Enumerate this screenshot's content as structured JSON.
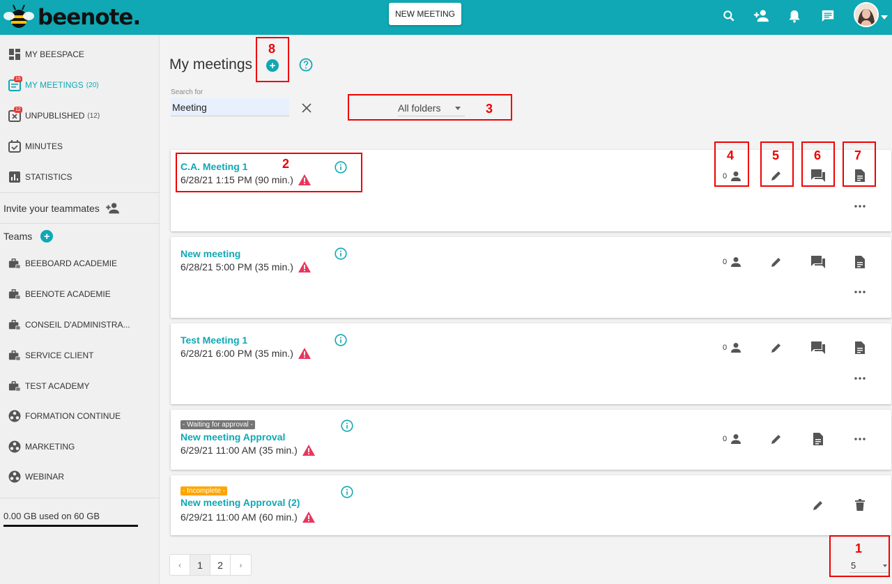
{
  "brand": {
    "logo_text": "beenote."
  },
  "topbar": {
    "new_meeting_label": "NEW MEETING"
  },
  "sidebar": {
    "items": [
      {
        "label": "MY BEESPACE",
        "count": "",
        "badge": ""
      },
      {
        "label": "MY MEETINGS",
        "count": "(20)",
        "badge": "15"
      },
      {
        "label": "UNPUBLISHED",
        "count": "(12)",
        "badge": "12"
      },
      {
        "label": "MINUTES",
        "count": "",
        "badge": ""
      },
      {
        "label": "STATISTICS",
        "count": "",
        "badge": ""
      }
    ],
    "invite_label": "Invite your teammates",
    "teams_label": "Teams",
    "teams": [
      {
        "label": "BEEBOARD ACADEMIE"
      },
      {
        "label": "BEENOTE ACADEMIE"
      },
      {
        "label": "CONSEIL D'ADMINISTRA..."
      },
      {
        "label": "SERVICE CLIENT"
      },
      {
        "label": "TEST ACADEMY"
      },
      {
        "label": "FORMATION CONTINUE"
      },
      {
        "label": "MARKETING"
      },
      {
        "label": "WEBINAR"
      }
    ],
    "storage": "0.00 GB used on 60 GB"
  },
  "main": {
    "title": "My meetings",
    "search_label": "Search for",
    "search_value": "Meeting",
    "folder_filter": "All folders",
    "meetings": [
      {
        "title": "C.A. Meeting 1",
        "date": "6/28/21 1:15 PM (90 min.)",
        "attendees": "0",
        "tag": ""
      },
      {
        "title": "New meeting",
        "date": "6/28/21 5:00 PM (35 min.)",
        "attendees": "0",
        "tag": ""
      },
      {
        "title": "Test Meeting 1",
        "date": "6/28/21 6:00 PM (35 min.)",
        "attendees": "0",
        "tag": ""
      },
      {
        "title": "New meeting Approval",
        "date": "6/29/21 11:00 AM (35 min.)",
        "attendees": "0",
        "tag": "- Waiting for approval -"
      },
      {
        "title": "New meeting Approval (2)",
        "date": "6/29/21 11:00 AM (60 min.)",
        "attendees": "",
        "tag": "- Incomplete -"
      }
    ],
    "pagination": {
      "prev": "‹",
      "pages": [
        "1",
        "2"
      ],
      "next": "›",
      "per_page": "5"
    }
  },
  "callouts": [
    "1",
    "2",
    "3",
    "4",
    "5",
    "6",
    "7",
    "8"
  ],
  "colors": {
    "accent": "#0fa8b4",
    "warning": "#e8365d",
    "callout": "#e00000"
  }
}
